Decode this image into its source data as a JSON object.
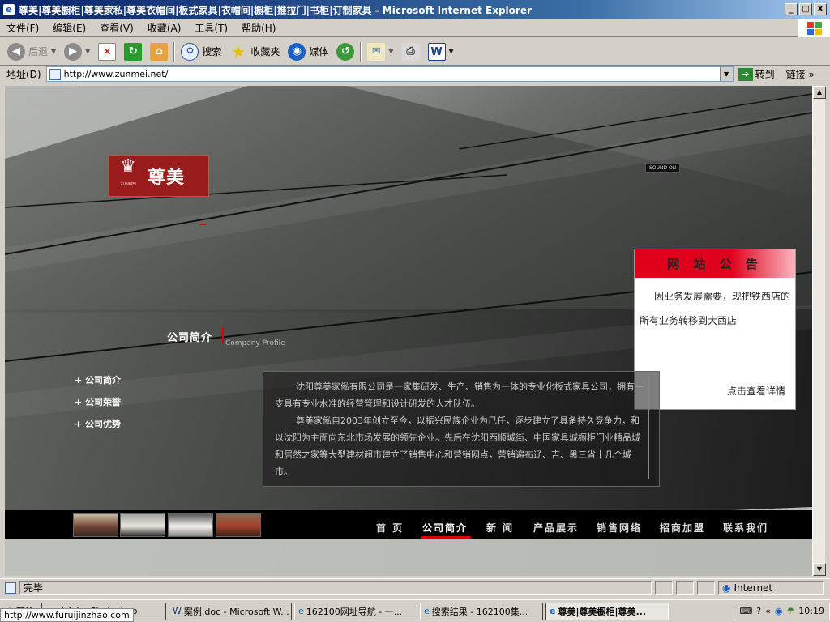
{
  "window": {
    "title": "尊美|尊美橱柜|尊美家私|尊美衣帽间|板式家具|衣帽间|橱柜|推拉门|书柜|订制家具 - Microsoft Internet Explorer",
    "buttons": {
      "minimize": "_",
      "maximize": "□",
      "close": "X"
    }
  },
  "menu": [
    "文件(F)",
    "编辑(E)",
    "查看(V)",
    "收藏(A)",
    "工具(T)",
    "帮助(H)"
  ],
  "toolbar": {
    "back": "后退",
    "search": "搜索",
    "favorites": "收藏夹",
    "media": "媒体"
  },
  "address": {
    "label": "地址(D)",
    "url": "http://www.zunmei.net/",
    "go": "转到",
    "links": "链接"
  },
  "site": {
    "logo": {
      "name": "尊美",
      "small_text": "ZUNMEI"
    },
    "sound": "SOUND ON",
    "notice": {
      "title": "网 站 公 告",
      "body": "因业务发展需要，现把铁西店的所有业务转移到大西店",
      "more": "点击查看详情"
    },
    "section": {
      "title": "公司简介",
      "subtitle": "Company Profile"
    },
    "side_menu": [
      "+ 公司简介",
      "+ 公司荣誉",
      "+ 公司优势"
    ],
    "intro": [
      "沈阳尊美家俬有限公司是一家集研发、生产、销售为一体的专业化板式家具公司，拥有一支具有专业水准的经营管理和设计研发的人才队伍。",
      "尊美家俬自2003年创立至今，以振兴民族企业为己任，逐步建立了具备持久竞争力，和以沈阳为主面向东北市场发展的领先企业。先后在沈阳西顺城街、中国家具城橱柜门业精品城和居然之家等大型建材超市建立了销售中心和营销网点，营销遍布辽、吉、黑三省十几个城市。"
    ],
    "nav": [
      "首 页",
      "公司简介",
      "新 闻",
      "产品展示",
      "销售网络",
      "招商加盟",
      "联系我们"
    ]
  },
  "status": {
    "text": "完毕",
    "zone": "Internet"
  },
  "taskbar": {
    "start": "开始",
    "tasks": [
      "Adobe Photoshop",
      "案例.doc - Microsoft W...",
      "162100网址导航 - 一...",
      "搜索结果 - 162100集...",
      "尊美|尊美橱柜|尊美..."
    ],
    "time": "10:19",
    "tooltip": "http://www.furuijinzhao.com"
  },
  "colors": {
    "accent_red": "#d00000",
    "notice_red": "#e0001b",
    "titlebar": "#0a246a",
    "logo_red": "#9b1c1c"
  }
}
